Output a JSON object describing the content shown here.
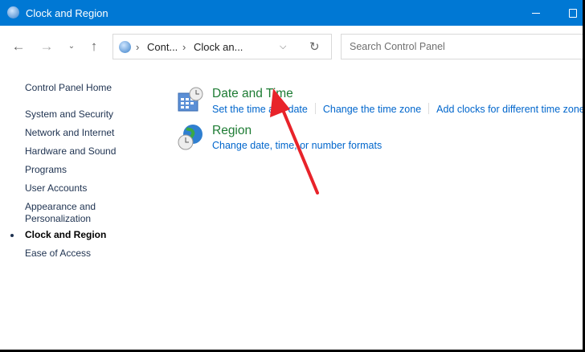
{
  "window": {
    "title": "Clock and Region"
  },
  "nav": {
    "breadcrumb": [
      "Cont...",
      "Clock an..."
    ],
    "search_placeholder": "Search Control Panel"
  },
  "sidebar": {
    "items": [
      {
        "label": "Control Panel Home"
      },
      {
        "label": "System and Security"
      },
      {
        "label": "Network and Internet"
      },
      {
        "label": "Hardware and Sound"
      },
      {
        "label": "Programs"
      },
      {
        "label": "User Accounts"
      },
      {
        "label": "Appearance and"
      },
      {
        "label": "Personalization"
      },
      {
        "label": "Clock and Region",
        "current": true
      },
      {
        "label": "Ease of Access"
      }
    ]
  },
  "categories": [
    {
      "title": "Date and Time",
      "links": [
        "Set the time and date",
        "Change the time zone",
        "Add clocks for different time zones"
      ]
    },
    {
      "title": "Region",
      "links": [
        "Change date, time, or number formats"
      ]
    }
  ],
  "colors": {
    "titlebar": "#0078d4",
    "link": "#0066cc",
    "heading": "#1e7c34",
    "annotation_arrow": "#e8232a"
  }
}
